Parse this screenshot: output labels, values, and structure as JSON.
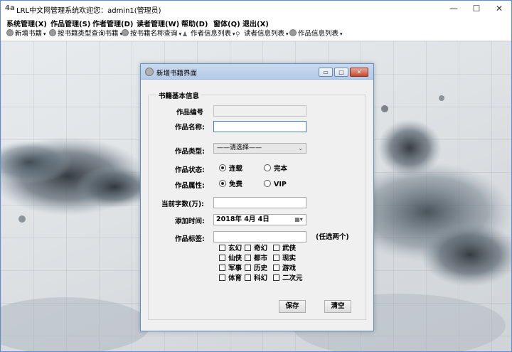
{
  "window": {
    "app_icon_text": "4a",
    "title": "LRL中文网管理系统欢迎您：admin1(管理员)",
    "minimize_glyph": "—",
    "maximize_glyph": "☐",
    "close_glyph": "✕"
  },
  "menu": [
    "系统管理(X)",
    "作品管理(S)",
    "作者管理(D)",
    "读者管理(W)",
    "帮助(D)",
    "窗体(Q)",
    "退出(X)"
  ],
  "toolbar": [
    {
      "label": "新增书籍",
      "icon": "gear-icon"
    },
    {
      "label": "按书籍类型查询书籍",
      "icon": "gear-icon"
    },
    {
      "label": "按书籍名称查询",
      "icon": "gear-icon"
    },
    {
      "label": "作者信息列表",
      "icon": "person-icon"
    },
    {
      "label": "读者信息列表",
      "icon": "reader-icon"
    },
    {
      "label": "作品信息列表",
      "icon": "gear-icon"
    }
  ],
  "dialog": {
    "title": "新增书籍界面",
    "group_title": "书籍基本信息",
    "fields": {
      "work_id_label": "作品编号",
      "work_id_value": "",
      "work_name_label": "作品名称:",
      "work_name_value": "",
      "work_type_label": "作品类型:",
      "work_type_value": "——请选择——",
      "work_status_label": "作品状态:",
      "status_options": [
        "连载",
        "完本"
      ],
      "status_selected": "连载",
      "work_attr_label": "作品属性:",
      "attr_options": [
        "免费",
        "VIP"
      ],
      "attr_selected": "免费",
      "word_count_label": "当前字数(万):",
      "word_count_value": "",
      "add_time_label": "添加时间:",
      "add_time_value": "2018年  4月  4日",
      "tags_label": "作品标签:",
      "tags_value": "",
      "tags_hint": "(任选两个)"
    },
    "tags": [
      "玄幻",
      "奇幻",
      "武侠",
      "仙侠",
      "都市",
      "现实",
      "军事",
      "历史",
      "游戏",
      "体育",
      "科幻",
      "二次元"
    ],
    "save_label": "保存",
    "clear_label": "清空"
  },
  "colors": {
    "accent": "#3d7bd3",
    "dialog_bg": "#f0f0f0",
    "close_red": "#c94a31"
  }
}
